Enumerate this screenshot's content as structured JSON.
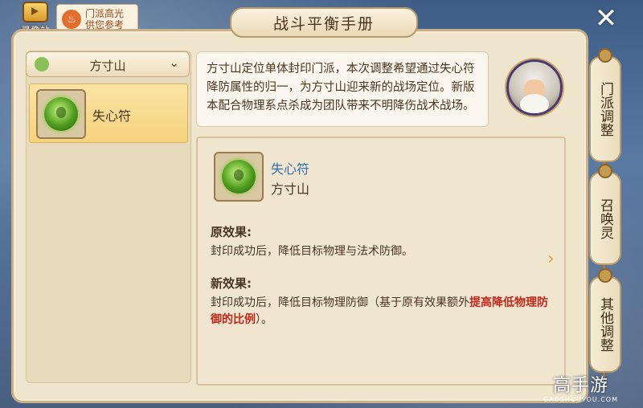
{
  "header": {
    "replay_label": "录像站",
    "highlight_text_line1": "门派高光",
    "highlight_text_line2": "供您参考",
    "title": "战斗平衡手册",
    "close_symbol": "✕"
  },
  "sidebar": {
    "sect_selector": "方寸山",
    "skills": [
      {
        "label": "失心符",
        "selected": true,
        "icon": "talisman-icon"
      }
    ]
  },
  "intro": {
    "text": "方寸山定位单体封印门派，本次调整希望通过失心符降防属性的归一，为方寸山迎来新的战场定位。新版本配合物理系点杀成为团队带来不明降伤战术战场。"
  },
  "detail": {
    "skill_name": "失心符",
    "sect": "方寸山",
    "original_heading": "原效果:",
    "original_text": "封印成功后，降低目标物理与法术防御。",
    "new_heading": "新效果:",
    "new_text_plain": "封印成功后，降低目标物理防御（基于原有效果额外",
    "new_text_highlight": "提高降低物理防御的比例",
    "new_text_end": "）。",
    "highlight_color": "#c0281b"
  },
  "right_tabs": [
    {
      "label": "门派调整"
    },
    {
      "label": "召唤灵"
    },
    {
      "label": "其他调整"
    }
  ],
  "watermark": {
    "brand": "高手游",
    "domain": "GAOSHOUYOU.COM"
  },
  "colors": {
    "panel": "#efe4cc",
    "selected_item": "#f5d27d",
    "skill_name_blue": "#2f6fb5"
  }
}
